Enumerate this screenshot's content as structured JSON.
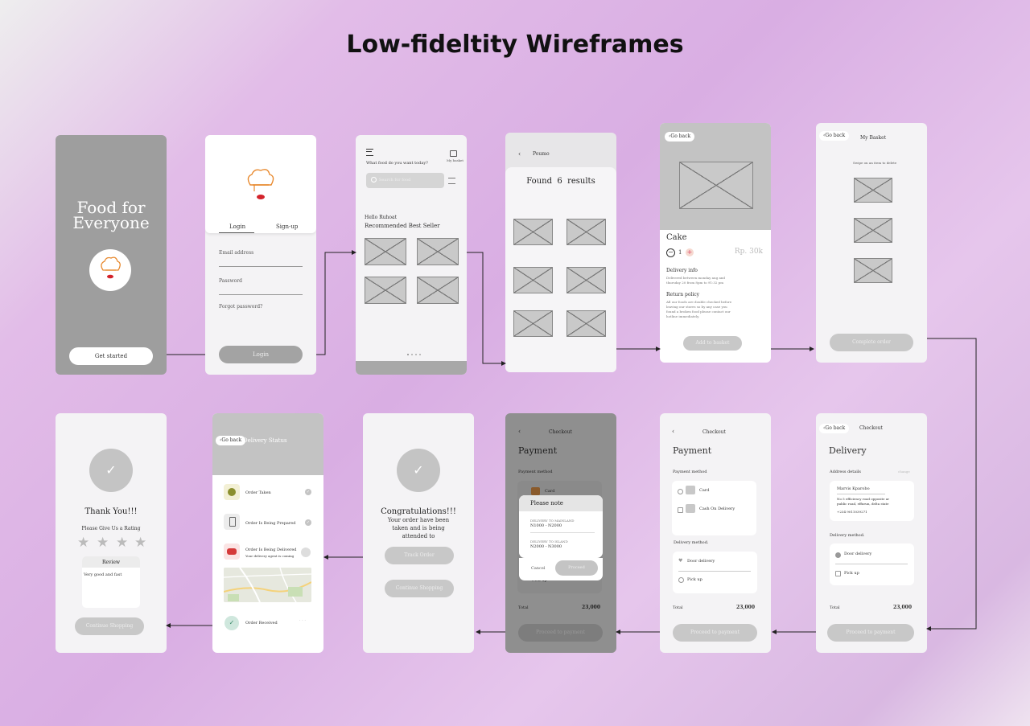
{
  "title": "Low-fideltity Wireframes",
  "s1": {
    "headline1": "Food for",
    "headline2": "Everyone",
    "cta": "Get started"
  },
  "s2": {
    "tab_login": "Login",
    "tab_signup": "Sign-up",
    "email": "Email address",
    "password": "Password",
    "forgot": "Forgot password?",
    "login_btn": "Login"
  },
  "s3": {
    "prompt": "What food do you want today?",
    "basket": "My basket",
    "search": "Search for food",
    "hello": "Hello Ruhoat",
    "section": "Recommended Best Seller"
  },
  "s4": {
    "query": "Poumo",
    "found": "Found",
    "count": "6",
    "results": "results"
  },
  "s5": {
    "back": "Go back",
    "name": "Cake",
    "qty": "1",
    "price": "Rp. 30k",
    "delivery_title": "Delivery info",
    "delivery_text1": "Delivered between monday aug and",
    "delivery_text2": "thursday 20 from 8pm to 91:32 pm",
    "return_title": "Return policy",
    "return_text1": "All our foods are double checked before",
    "return_text2": "leaving our stores so by any case you",
    "return_text3": "found a broken food please contact our",
    "return_text4": "hotline immediately.",
    "add_btn": "Add to basket"
  },
  "s6": {
    "back": "Go back",
    "title": "My Basket",
    "hint": "Swipe on an item to delete",
    "complete_btn": "Complete order"
  },
  "s7": {
    "back": "Go back",
    "title": "Checkout",
    "heading": "Delivery",
    "address_label": "Address details",
    "change": "change",
    "name": "Marvis Kparobo",
    "address1": "No 5 efficiency road opposite ar",
    "address2": "public road, effurun, delta state",
    "phone": "+234 9011039271",
    "method_label": "Delivery method.",
    "opt1": "Door delivery",
    "opt2": "Pick up",
    "total_label": "Total",
    "total_value": "23,000",
    "proceed_btn": "Proceed to payment"
  },
  "s8": {
    "title": "Checkout",
    "heading": "Payment",
    "method_label": "Payment method",
    "opt1": "Card",
    "opt2": "Cash On Delivery",
    "delivery_label": "Delivery method.",
    "d1": "Door delivery",
    "d2": "Pick up",
    "total_label": "Total",
    "total_value": "23,000",
    "proceed_btn": "Proceed to payment"
  },
  "s9": {
    "title": "Checkout",
    "heading": "Payment",
    "method_label": "Payment method",
    "opt1": "Card",
    "behind": "Pick up",
    "total_label": "Total",
    "total_value": "23,000",
    "proceed_btn": "Proceed to payment",
    "modal_title": "Please note",
    "m_label1": "DELIVERY TO MAINLAND",
    "m_value1": "N1000 - N2000",
    "m_label2": "DELIVERY TO ISLAND",
    "m_value2": "N2000 - N3000",
    "cancel": "Cancel",
    "proceed": "Proceed"
  },
  "s10": {
    "heading": "Congratulations!!!",
    "line1": "Your order have been",
    "line2": "taken and is being",
    "line3": "attended to",
    "track_btn": "Track Order",
    "continue_btn": "Continue Shopping"
  },
  "s11": {
    "back": "Go back",
    "title": "Delivery Status",
    "st1": "Order Taken",
    "st2": "Order Is Being Prepared",
    "st3": "Order Is Being Delivered",
    "st3_sub": "Your delivery agent is coming",
    "st4": "Order Received"
  },
  "s12": {
    "heading": "Thank You!!!",
    "rating": "Please Give Us a Rating",
    "review_title": "Review",
    "review_text": "Very good and fast",
    "continue_btn": "Continue Shopping"
  }
}
